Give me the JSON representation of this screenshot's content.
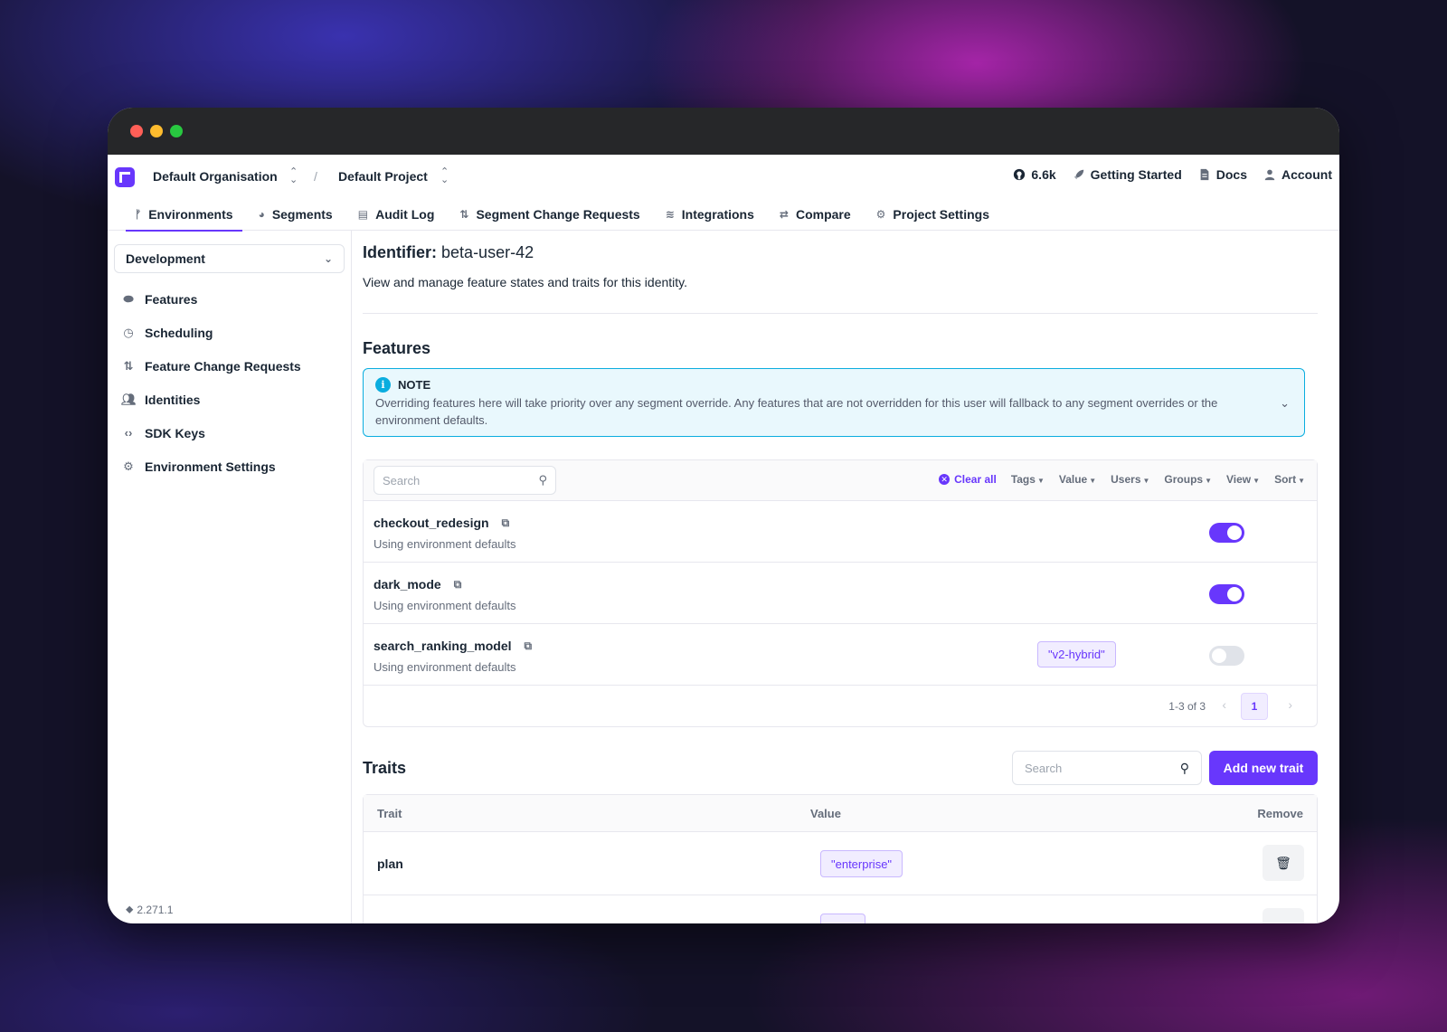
{
  "topnav": {
    "organisation": "Default Organisation",
    "project": "Default Project",
    "github_stars": "6.6k",
    "getting_started": "Getting Started",
    "docs": "Docs",
    "account": "Account"
  },
  "tabs": [
    {
      "label": "Environments",
      "icon": "branch-icon"
    },
    {
      "label": "Segments",
      "icon": "pie-icon"
    },
    {
      "label": "Audit Log",
      "icon": "list-icon"
    },
    {
      "label": "Segment Change Requests",
      "icon": "pull-request-icon"
    },
    {
      "label": "Integrations",
      "icon": "layers-icon"
    },
    {
      "label": "Compare",
      "icon": "compare-icon"
    },
    {
      "label": "Project Settings",
      "icon": "gear-icon"
    }
  ],
  "sidebar": {
    "environment": "Development",
    "items": [
      {
        "label": "Features",
        "icon": "toggle-icon"
      },
      {
        "label": "Scheduling",
        "icon": "clock-icon"
      },
      {
        "label": "Feature Change Requests",
        "icon": "pull-request-icon"
      },
      {
        "label": "Identities",
        "icon": "users-icon"
      },
      {
        "label": "SDK Keys",
        "icon": "code-icon"
      },
      {
        "label": "Environment Settings",
        "icon": "gear-icon"
      }
    ],
    "version": "2.271.1"
  },
  "identity": {
    "label": "Identifier:",
    "value": "beta-user-42",
    "subtitle": "View and manage feature states and traits for this identity."
  },
  "features": {
    "title": "Features",
    "note": {
      "heading": "NOTE",
      "text": "Overriding features here will take priority over any segment override. Any features that are not overridden for this user will fallback to any segment overrides or the environment defaults."
    },
    "search_placeholder": "Search",
    "filters": {
      "clear_all": "Clear all",
      "tags": "Tags",
      "value": "Value",
      "users": "Users",
      "groups": "Groups",
      "view": "View",
      "sort": "Sort"
    },
    "rows": [
      {
        "name": "checkout_redesign",
        "description": "Using environment defaults",
        "enabled": true,
        "value": ""
      },
      {
        "name": "dark_mode",
        "description": "Using environment defaults",
        "enabled": true,
        "value": ""
      },
      {
        "name": "search_ranking_model",
        "description": "Using environment defaults",
        "enabled": false,
        "value": "\"v2-hybrid\""
      }
    ],
    "pagination": {
      "info": "1-3 of 3",
      "page": "1"
    }
  },
  "traits": {
    "title": "Traits",
    "search_placeholder": "Search",
    "add_button": "Add new trait",
    "columns": {
      "trait": "Trait",
      "value": "Value",
      "remove": "Remove"
    },
    "rows": [
      {
        "key": "plan",
        "value": "\"enterprise\""
      }
    ]
  },
  "colors": {
    "accent": "#6837fc",
    "info": "#0aaddf"
  }
}
